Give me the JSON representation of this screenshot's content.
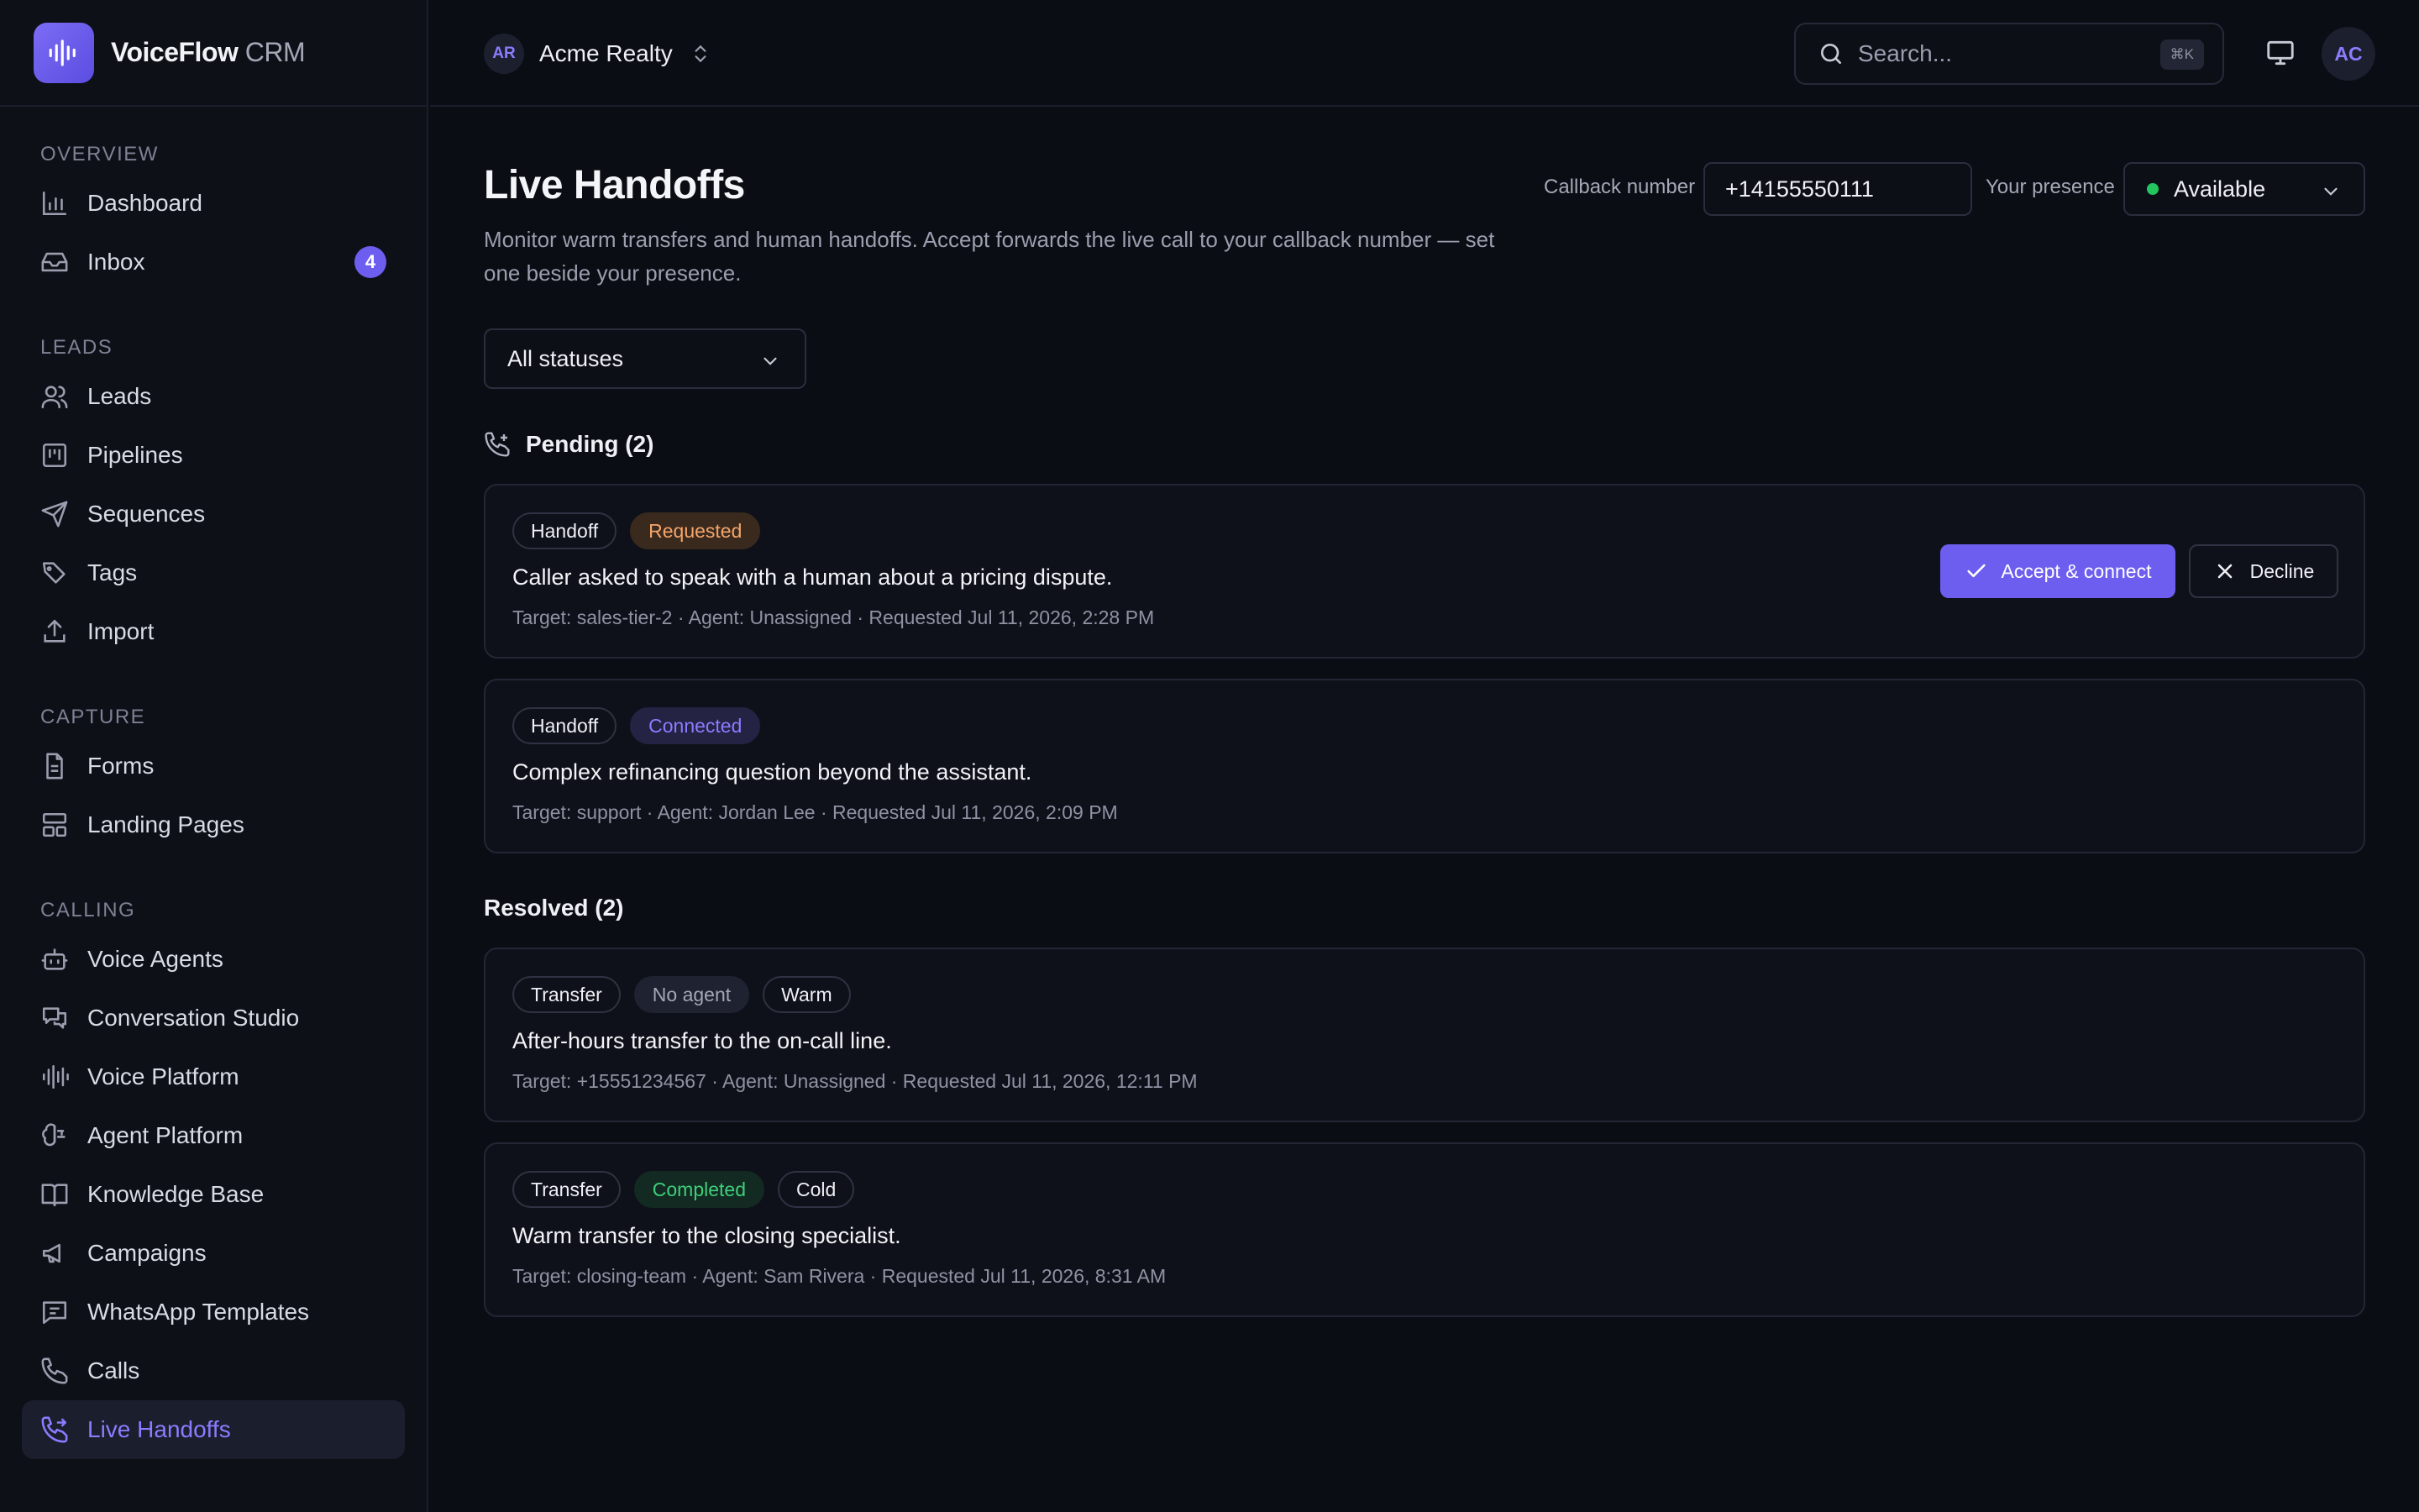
{
  "brand": {
    "name_bold": "VoiceFlow",
    "name_light": "CRM"
  },
  "sidebar": {
    "sections": [
      {
        "label": "OVERVIEW",
        "items": [
          {
            "label": "Dashboard",
            "icon": "bar-chart-icon"
          },
          {
            "label": "Inbox",
            "icon": "inbox-icon",
            "badge": "4"
          }
        ]
      },
      {
        "label": "LEADS",
        "items": [
          {
            "label": "Leads",
            "icon": "users-icon"
          },
          {
            "label": "Pipelines",
            "icon": "kanban-icon"
          },
          {
            "label": "Sequences",
            "icon": "send-icon"
          },
          {
            "label": "Tags",
            "icon": "tags-icon"
          },
          {
            "label": "Import",
            "icon": "upload-icon"
          }
        ]
      },
      {
        "label": "CAPTURE",
        "items": [
          {
            "label": "Forms",
            "icon": "file-text-icon"
          },
          {
            "label": "Landing Pages",
            "icon": "layout-icon"
          }
        ]
      },
      {
        "label": "CALLING",
        "items": [
          {
            "label": "Voice Agents",
            "icon": "bot-icon"
          },
          {
            "label": "Conversation Studio",
            "icon": "messages-icon"
          },
          {
            "label": "Voice Platform",
            "icon": "audio-lines-icon"
          },
          {
            "label": "Agent Platform",
            "icon": "brain-icon"
          },
          {
            "label": "Knowledge Base",
            "icon": "book-icon"
          },
          {
            "label": "Campaigns",
            "icon": "megaphone-icon"
          },
          {
            "label": "WhatsApp Templates",
            "icon": "message-square-icon"
          },
          {
            "label": "Calls",
            "icon": "phone-icon"
          },
          {
            "label": "Live Handoffs",
            "icon": "phone-forwarded-icon",
            "active": true
          }
        ]
      }
    ]
  },
  "topbar": {
    "org_initials": "AR",
    "org_name": "Acme Realty",
    "search_placeholder": "Search...",
    "search_shortcut": "⌘K",
    "user_initials": "AC"
  },
  "page": {
    "title": "Live Handoffs",
    "description": "Monitor warm transfers and human handoffs. Accept forwards the live call to your callback number — set one beside your presence.",
    "callback_label": "Callback number",
    "callback_value": "+14155550111",
    "presence_label": "Your presence",
    "presence_value": "Available",
    "filter_value": "All statuses"
  },
  "pending": {
    "heading": "Pending (2)",
    "cards": [
      {
        "tags": [
          {
            "text": "Handoff",
            "style": "outline"
          },
          {
            "text": "Requested",
            "style": "requested"
          }
        ],
        "title": "Caller asked to speak with a human about a pricing dispute.",
        "meta": "Target: sales-tier-2 · Agent: Unassigned · Requested Jul 11, 2026, 2:28 PM",
        "accept_label": "Accept & connect",
        "decline_label": "Decline"
      },
      {
        "tags": [
          {
            "text": "Handoff",
            "style": "outline"
          },
          {
            "text": "Connected",
            "style": "connected"
          }
        ],
        "title": "Complex refinancing question beyond the assistant.",
        "meta": "Target: support · Agent: Jordan Lee · Requested Jul 11, 2026, 2:09 PM"
      }
    ]
  },
  "resolved": {
    "heading": "Resolved (2)",
    "cards": [
      {
        "tags": [
          {
            "text": "Transfer",
            "style": "outline"
          },
          {
            "text": "No agent",
            "style": "noagent"
          },
          {
            "text": "Warm",
            "style": "outline"
          }
        ],
        "title": "After-hours transfer to the on-call line.",
        "meta": "Target: +15551234567 · Agent: Unassigned · Requested Jul 11, 2026, 12:11 PM"
      },
      {
        "tags": [
          {
            "text": "Transfer",
            "style": "outline"
          },
          {
            "text": "Completed",
            "style": "completed"
          },
          {
            "text": "Cold",
            "style": "outline"
          }
        ],
        "title": "Warm transfer to the closing specialist.",
        "meta": "Target: closing-team · Agent: Sam Rivera · Requested Jul 11, 2026, 8:31 AM"
      }
    ]
  },
  "colors": {
    "accent": "#6d5ef0",
    "presence_available": "#22c55e"
  }
}
